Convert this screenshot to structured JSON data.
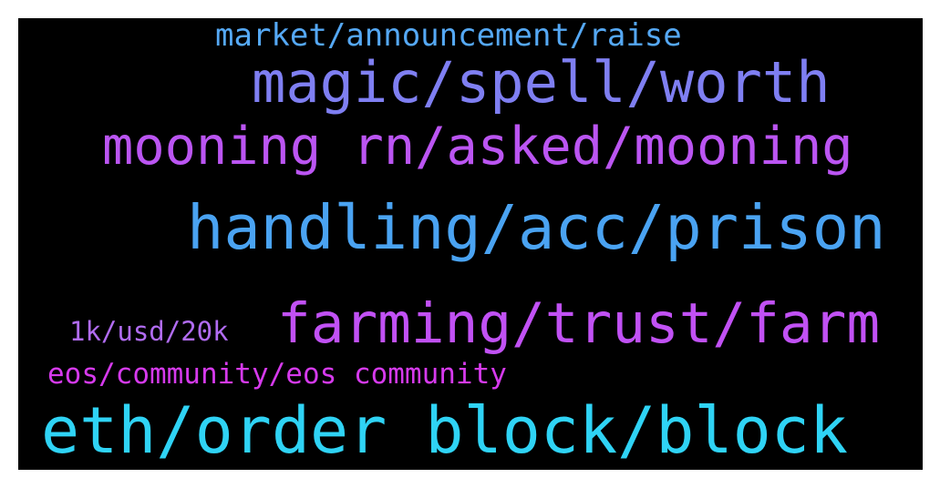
{
  "wordcloud": {
    "background": "#000000",
    "words": [
      {
        "text": "market/announcement/raise",
        "color": "#55a8f4"
      },
      {
        "text": "magic/spell/worth",
        "color": "#7f7ff2"
      },
      {
        "text": "mooning rn/asked/mooning",
        "color": "#bb55f2"
      },
      {
        "text": "handling/acc/prison",
        "color": "#4aa3f2"
      },
      {
        "text": "1k/usd/20k",
        "color": "#b16cf2"
      },
      {
        "text": "farming/trust/farm",
        "color": "#c151f4"
      },
      {
        "text": "eos/community/eos community",
        "color": "#d63aed"
      },
      {
        "text": "eth/order block/block",
        "color": "#2fd3f5"
      }
    ]
  }
}
